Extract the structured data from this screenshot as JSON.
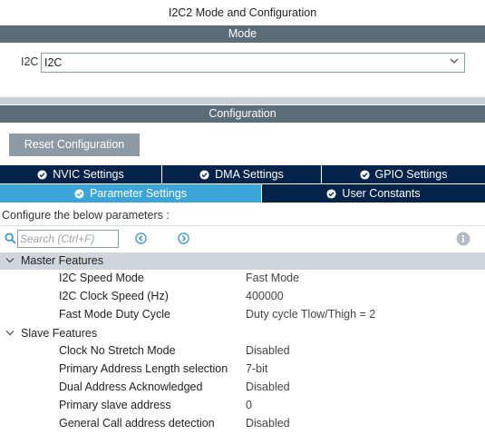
{
  "window": {
    "title": "I2C2 Mode and Configuration"
  },
  "mode_section": {
    "header": "Mode",
    "field_label": "I2C",
    "selected_value": "I2C"
  },
  "config_section": {
    "header": "Configuration",
    "reset_label": "Reset Configuration"
  },
  "tabs": {
    "row1": [
      {
        "label": "NVIC Settings"
      },
      {
        "label": "DMA Settings"
      },
      {
        "label": "GPIO Settings"
      }
    ],
    "row2": [
      {
        "label": "Parameter Settings",
        "active": true
      },
      {
        "label": "User Constants"
      }
    ]
  },
  "parameters": {
    "hint": "Configure the below parameters :",
    "search_placeholder": "Search (Ctrl+F)",
    "groups": [
      {
        "label": "Master Features",
        "rows": [
          {
            "name": "I2C Speed Mode",
            "value": "Fast Mode"
          },
          {
            "name": "I2C Clock Speed (Hz)",
            "value": "400000"
          },
          {
            "name": "Fast Mode Duty Cycle",
            "value": "Duty cycle Tlow/Thigh = 2"
          }
        ]
      },
      {
        "label": "Slave Features",
        "rows": [
          {
            "name": "Clock No Stretch Mode",
            "value": "Disabled"
          },
          {
            "name": "Primary Address Length selection",
            "value": "7-bit"
          },
          {
            "name": "Dual Address Acknowledged",
            "value": "Disabled"
          },
          {
            "name": "Primary slave address",
            "value": "0"
          },
          {
            "name": "General Call address detection",
            "value": "Disabled"
          }
        ]
      }
    ]
  },
  "colors": {
    "section_bar": "#5c6c78",
    "tab_dark": "#03234b",
    "tab_active": "#3ba4d8",
    "group_highlight": "#cfd5da"
  },
  "icons": {
    "tab_check": "check-circle-icon",
    "search": "search-icon",
    "prev": "arrow-left-circle-icon",
    "next": "arrow-right-circle-icon",
    "info": "info-icon",
    "dropdown": "chevron-down-icon"
  }
}
